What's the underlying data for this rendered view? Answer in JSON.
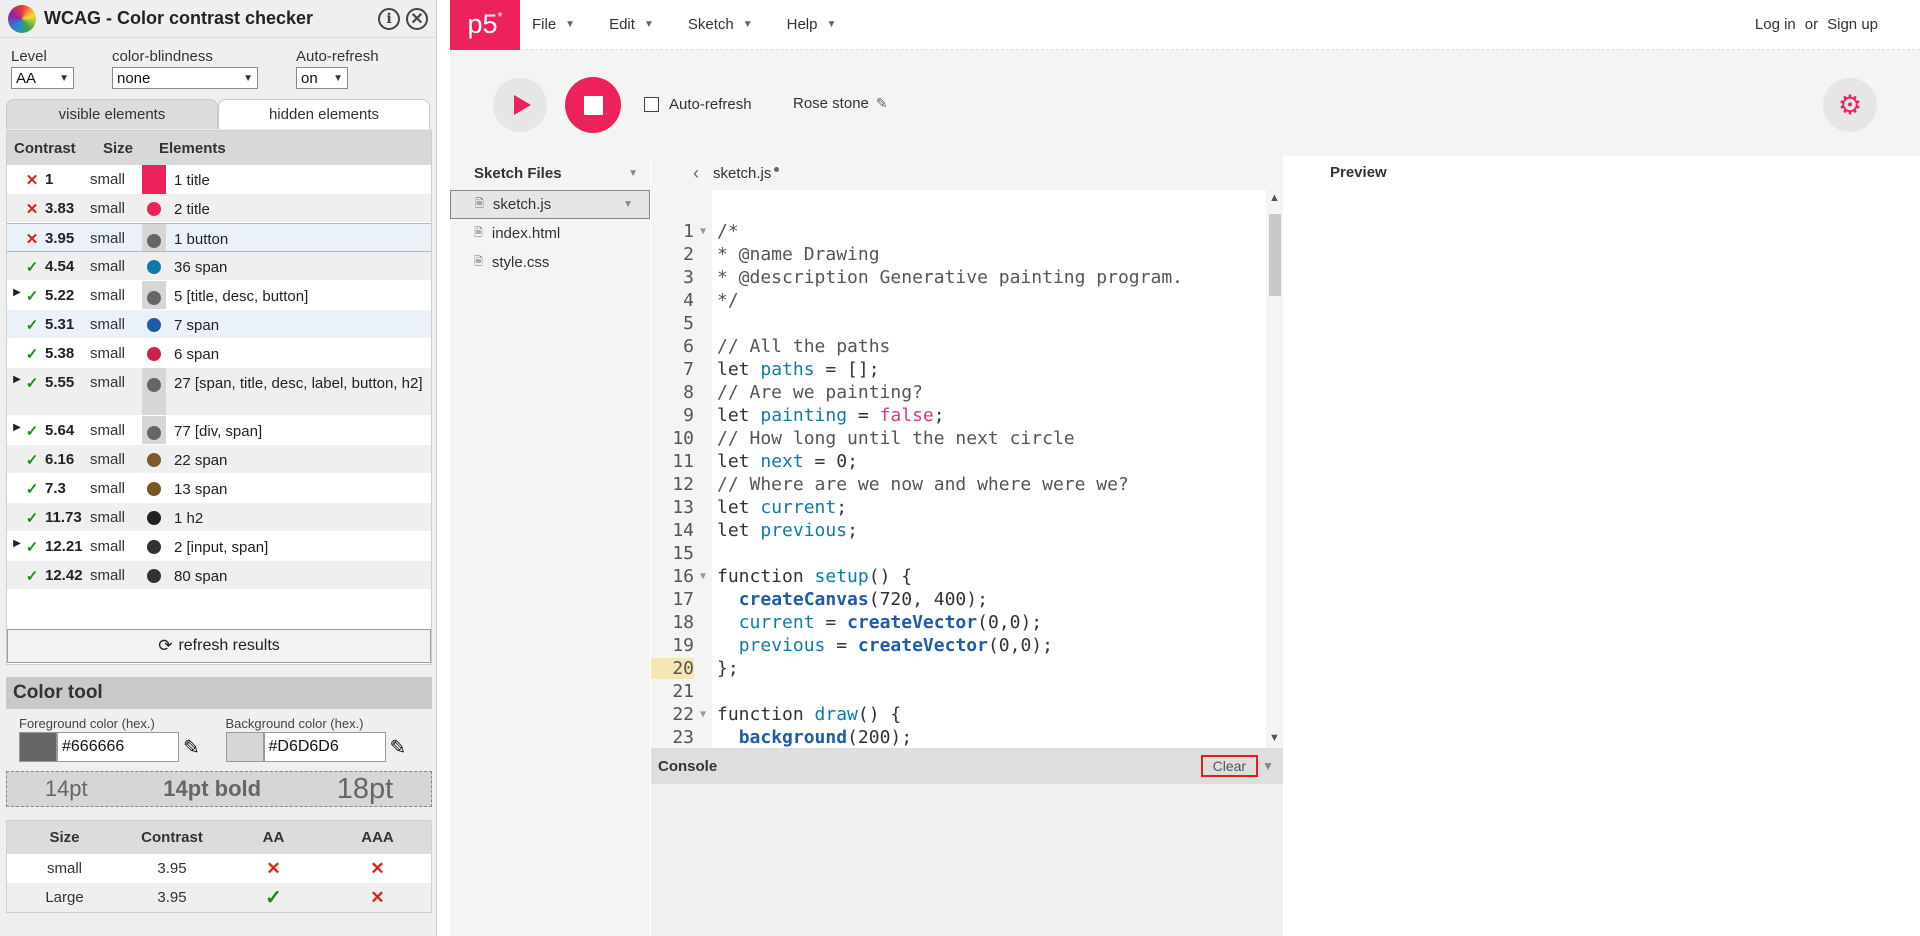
{
  "wcag": {
    "title": "WCAG - Color contrast checker",
    "info_icon": "i",
    "close_icon": "✕",
    "level_label": "Level",
    "level_value": "AA",
    "cb_label": "color-blindness",
    "cb_value": "none",
    "ar_label": "Auto-refresh",
    "ar_value": "on",
    "tabs": [
      "visible elements",
      "hidden elements"
    ],
    "table_headers": {
      "contrast": "Contrast",
      "size": "Size",
      "elements": "Elements"
    },
    "rows": [
      {
        "exp": "",
        "mark": "✕",
        "ok": false,
        "val": "1",
        "size": "small",
        "swatch": "#ed225d",
        "shape": "square",
        "el": "1 title"
      },
      {
        "exp": "",
        "mark": "✕",
        "ok": false,
        "val": "3.83",
        "size": "small",
        "swatch": "#ed225d",
        "shape": "dot",
        "el": "2 title"
      },
      {
        "exp": "",
        "mark": "✕",
        "ok": false,
        "val": "3.95",
        "size": "small",
        "swatch": "#666666",
        "shape": "dot",
        "el": "1 button"
      },
      {
        "exp": "",
        "mark": "✓",
        "ok": true,
        "val": "4.54",
        "size": "small",
        "swatch": "#0b7ca9",
        "shape": "dot",
        "el": "36 span"
      },
      {
        "exp": "▶",
        "mark": "✓",
        "ok": true,
        "val": "5.22",
        "size": "small",
        "swatch": "#666666",
        "shape": "dot",
        "el": "5 [title, desc, button]"
      },
      {
        "exp": "",
        "mark": "✓",
        "ok": true,
        "val": "5.31",
        "size": "small",
        "swatch": "#1f5ba8",
        "shape": "dot",
        "el": "7 span"
      },
      {
        "exp": "",
        "mark": "✓",
        "ok": true,
        "val": "5.38",
        "size": "small",
        "swatch": "#c8244f",
        "shape": "dot",
        "el": "6 span"
      },
      {
        "exp": "▶",
        "mark": "✓",
        "ok": true,
        "val": "5.55",
        "size": "small",
        "swatch": "#666666",
        "shape": "dot",
        "el": "27 [span, title, desc, label, button, h2]"
      },
      {
        "exp": "▶",
        "mark": "✓",
        "ok": true,
        "val": "5.64",
        "size": "small",
        "swatch": "#666666",
        "shape": "dot",
        "el": "77 [div, span]"
      },
      {
        "exp": "",
        "mark": "✓",
        "ok": true,
        "val": "6.16",
        "size": "small",
        "swatch": "#7d5a2c",
        "shape": "dot",
        "el": "22 span"
      },
      {
        "exp": "",
        "mark": "✓",
        "ok": true,
        "val": "7.3",
        "size": "small",
        "swatch": "#7a5520",
        "shape": "dot",
        "el": "13 span"
      },
      {
        "exp": "",
        "mark": "✓",
        "ok": true,
        "val": "11.73",
        "size": "small",
        "swatch": "#222222",
        "shape": "dot",
        "el": "1 h2"
      },
      {
        "exp": "▶",
        "mark": "✓",
        "ok": true,
        "val": "12.21",
        "size": "small",
        "swatch": "#333333",
        "shape": "dot",
        "el": "2 [input, span]"
      },
      {
        "exp": "",
        "mark": "✓",
        "ok": true,
        "val": "12.42",
        "size": "small",
        "swatch": "#333333",
        "shape": "dot",
        "el": "80 span"
      }
    ],
    "refresh_label": "refresh results",
    "color_tool": {
      "title": "Color tool",
      "fg_label": "Foreground color (hex.)",
      "fg_value": "#666666",
      "bg_label": "Background color (hex.)",
      "bg_value": "#D6D6D6",
      "fg_color": "#666666",
      "bg_color": "#d6d6d6",
      "preview": [
        "14pt",
        "14pt bold",
        "18pt"
      ],
      "headers": [
        "Size",
        "Contrast",
        "AA",
        "AAA"
      ],
      "rows": [
        {
          "size": "small",
          "contrast": "3.95",
          "aa": "✕",
          "aa_ok": false,
          "aaa": "✕",
          "aaa_ok": false
        },
        {
          "size": "Large",
          "contrast": "3.95",
          "aa": "✓",
          "aa_ok": true,
          "aaa": "✕",
          "aaa_ok": false
        }
      ]
    }
  },
  "p5": {
    "logo": "p5",
    "logo_sup": "*",
    "menu": [
      "File",
      "Edit",
      "Sketch",
      "Help"
    ],
    "login": "Log in",
    "or": "or",
    "signup": "Sign up",
    "auto_refresh": "Auto-refresh",
    "sketch_name": "Rose stone",
    "files_title": "Sketch Files",
    "files": [
      "sketch.js",
      "index.html",
      "style.css"
    ],
    "open_file": "sketch.js",
    "preview_label": "Preview",
    "console_label": "Console",
    "clear_label": "Clear",
    "accent": "#ed225d"
  },
  "code_lines": [
    {
      "n": "1",
      "fold": "▼",
      "hl": false,
      "parts": [
        [
          "cm",
          "/*"
        ]
      ]
    },
    {
      "n": "2",
      "fold": "",
      "hl": false,
      "parts": [
        [
          "cm",
          "* @name Drawing"
        ]
      ]
    },
    {
      "n": "3",
      "fold": "",
      "hl": false,
      "parts": [
        [
          "cm",
          "* @description Generative painting program."
        ]
      ]
    },
    {
      "n": "4",
      "fold": "",
      "hl": false,
      "parts": [
        [
          "cm",
          "*/"
        ]
      ]
    },
    {
      "n": "5",
      "fold": "",
      "hl": false,
      "parts": []
    },
    {
      "n": "6",
      "fold": "",
      "hl": false,
      "parts": [
        [
          "cm",
          "// All the paths"
        ]
      ]
    },
    {
      "n": "7",
      "fold": "",
      "hl": false,
      "parts": [
        [
          "kw",
          "let "
        ],
        [
          "var",
          "paths"
        ],
        [
          "kw",
          " = [];"
        ]
      ]
    },
    {
      "n": "8",
      "fold": "",
      "hl": false,
      "parts": [
        [
          "cm",
          "// Are we painting?"
        ]
      ]
    },
    {
      "n": "9",
      "fold": "",
      "hl": false,
      "parts": [
        [
          "kw",
          "let "
        ],
        [
          "var",
          "painting"
        ],
        [
          "kw",
          " = "
        ],
        [
          "red",
          "false"
        ],
        [
          "kw",
          ";"
        ]
      ]
    },
    {
      "n": "10",
      "fold": "",
      "hl": false,
      "parts": [
        [
          "cm",
          "// How long until the next circle"
        ]
      ]
    },
    {
      "n": "11",
      "fold": "",
      "hl": false,
      "parts": [
        [
          "kw",
          "let "
        ],
        [
          "var",
          "next"
        ],
        [
          "kw",
          " = 0;"
        ]
      ]
    },
    {
      "n": "12",
      "fold": "",
      "hl": false,
      "parts": [
        [
          "cm",
          "// Where are we now and where were we?"
        ]
      ]
    },
    {
      "n": "13",
      "fold": "",
      "hl": false,
      "parts": [
        [
          "kw",
          "let "
        ],
        [
          "var",
          "current"
        ],
        [
          "kw",
          ";"
        ]
      ]
    },
    {
      "n": "14",
      "fold": "",
      "hl": false,
      "parts": [
        [
          "kw",
          "let "
        ],
        [
          "var",
          "previous"
        ],
        [
          "kw",
          ";"
        ]
      ]
    },
    {
      "n": "15",
      "fold": "",
      "hl": false,
      "parts": []
    },
    {
      "n": "16",
      "fold": "▼",
      "hl": false,
      "parts": [
        [
          "kw",
          "function "
        ],
        [
          "fn",
          "setup"
        ],
        [
          "kw",
          "() {"
        ]
      ]
    },
    {
      "n": "17",
      "fold": "",
      "hl": false,
      "parts": [
        [
          "kw",
          "  "
        ],
        [
          "bfn",
          "createCanvas"
        ],
        [
          "kw",
          "(720, 400);"
        ]
      ]
    },
    {
      "n": "18",
      "fold": "",
      "hl": false,
      "parts": [
        [
          "kw",
          "  "
        ],
        [
          "var",
          "current"
        ],
        [
          "kw",
          " = "
        ],
        [
          "bfn",
          "createVector"
        ],
        [
          "kw",
          "(0,0);"
        ]
      ]
    },
    {
      "n": "19",
      "fold": "",
      "hl": false,
      "parts": [
        [
          "kw",
          "  "
        ],
        [
          "var",
          "previous"
        ],
        [
          "kw",
          " = "
        ],
        [
          "bfn",
          "createVector"
        ],
        [
          "kw",
          "(0,0);"
        ]
      ]
    },
    {
      "n": "20",
      "fold": "",
      "hl": true,
      "parts": [
        [
          "kw",
          "};"
        ]
      ]
    },
    {
      "n": "21",
      "fold": "",
      "hl": false,
      "parts": []
    },
    {
      "n": "22",
      "fold": "▼",
      "hl": false,
      "parts": [
        [
          "kw",
          "function "
        ],
        [
          "fn",
          "draw"
        ],
        [
          "kw",
          "() {"
        ]
      ]
    },
    {
      "n": "23",
      "fold": "",
      "hl": false,
      "parts": [
        [
          "kw",
          "  "
        ],
        [
          "bfn",
          "background"
        ],
        [
          "kw",
          "(200);"
        ]
      ]
    }
  ]
}
